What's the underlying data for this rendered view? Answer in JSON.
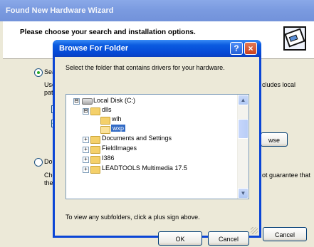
{
  "wizard": {
    "title": "Found New Hardware Wizard",
    "heading": "Please choose your search and installation options.",
    "option1_label": "Sear",
    "option1_text1": "Use",
    "option1_text2": "path",
    "option1_right_text": "cludes local",
    "browse_button": "wse",
    "option2_label": "Don",
    "option2_text1": "Cho",
    "option2_text2": "the d",
    "option2_right_text": "ot guarantee that",
    "cancel_button": "Cancel"
  },
  "dialog": {
    "title": "Browse For Folder",
    "help_label": "?",
    "close_label": "×",
    "instruction": "Select the folder that contains drivers for your hardware.",
    "tree": [
      {
        "label": "Local Disk (C:)",
        "expander": "⊟",
        "icon": "drive-icon"
      },
      {
        "label": "dlls",
        "expander": "⊟",
        "icon": "folder-icon"
      },
      {
        "label": "wlh",
        "expander": "",
        "icon": "folder-icon"
      },
      {
        "label": "wxp",
        "expander": "",
        "icon": "folder-open-icon",
        "selected": true
      },
      {
        "label": "Documents and Settings",
        "expander": "+",
        "icon": "folder-icon"
      },
      {
        "label": "FieldImages",
        "expander": "+",
        "icon": "folder-icon"
      },
      {
        "label": "I386",
        "expander": "+",
        "icon": "folder-icon"
      },
      {
        "label": "LEADTOOLS Multimedia 17.5",
        "expander": "+",
        "icon": "folder-icon"
      }
    ],
    "hint": "To view any subfolders, click a plus sign above.",
    "ok_button": "OK",
    "cancel_button": "Cancel"
  }
}
